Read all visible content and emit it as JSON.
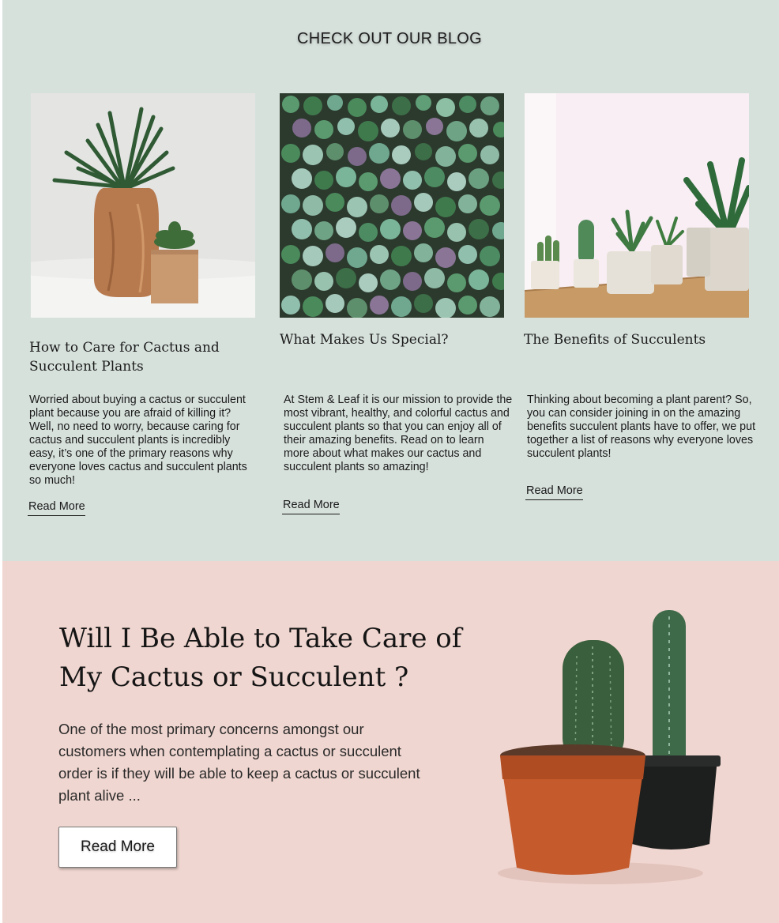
{
  "blog": {
    "heading": "CHECK OUT OUR BLOG",
    "cards": [
      {
        "image": "wooden-vase-and-succulent-photo",
        "title": "How to Care for Cactus and Succulent Plants",
        "text": "Worried about buying a cactus or succulent plant because you are afraid of killing it? Well, no need to worry, because caring for cactus and succulent plants is incredibly easy, it’s one of the primary reasons why everyone loves cactus and succulent plants so much!",
        "link": "Read More"
      },
      {
        "image": "succulent-wall-photo",
        "title": "What Makes Us Special?",
        "text": "At Stem & Leaf it is our mission to provide the most vibrant, healthy, and colorful cactus and succulent plants so that you can enjoy all of their amazing benefits. Read on to learn more about what makes our cactus and succulent plants so amazing!",
        "link": "Read More"
      },
      {
        "image": "potted-plants-on-shelf-photo",
        "title": "The Benefits of Succulents",
        "text": "Thinking about becoming a plant parent? So, you can consider joining in on the amazing benefits succulent plants have to offer, we put together a list of reasons why everyone loves succulent plants!",
        "link": "Read More"
      }
    ]
  },
  "promo": {
    "title": "Will I Be Able to Take Care of My Cactus or Succulent ?",
    "text": "One of the most primary concerns amongst our customers when contemplating a cactus or succulent order is if they will be able to keep a cactus or succulent plant alive ...",
    "button": "Read More",
    "image": "potted-cacti-photo"
  },
  "colors": {
    "blog_bg": "#d7e1dc",
    "promo_bg": "#f0d6d0"
  }
}
